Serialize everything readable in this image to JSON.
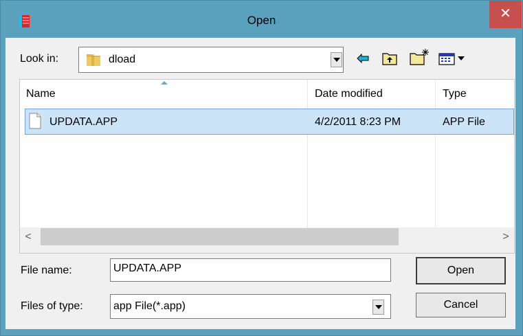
{
  "window": {
    "title": "Open",
    "close_label": "✕"
  },
  "look_in": {
    "label": "Look in:",
    "value": "dload"
  },
  "columns": {
    "name": "Name",
    "date_modified": "Date modified",
    "type": "Type"
  },
  "files": [
    {
      "name": "UPDATA.APP",
      "date_modified": "4/2/2011 8:23 PM",
      "type": "APP File"
    }
  ],
  "scrollbar": {
    "left_arrow": "<",
    "right_arrow": ">"
  },
  "file_name": {
    "label": "File name:",
    "value": "UPDATA.APP"
  },
  "files_of_type": {
    "label": "Files of type:",
    "value": "app File(*.app)"
  },
  "buttons": {
    "open": "Open",
    "cancel": "Cancel"
  },
  "colors": {
    "titlebar": "#5aa1bd",
    "close": "#c7504f",
    "selection": "#cce4f7"
  }
}
